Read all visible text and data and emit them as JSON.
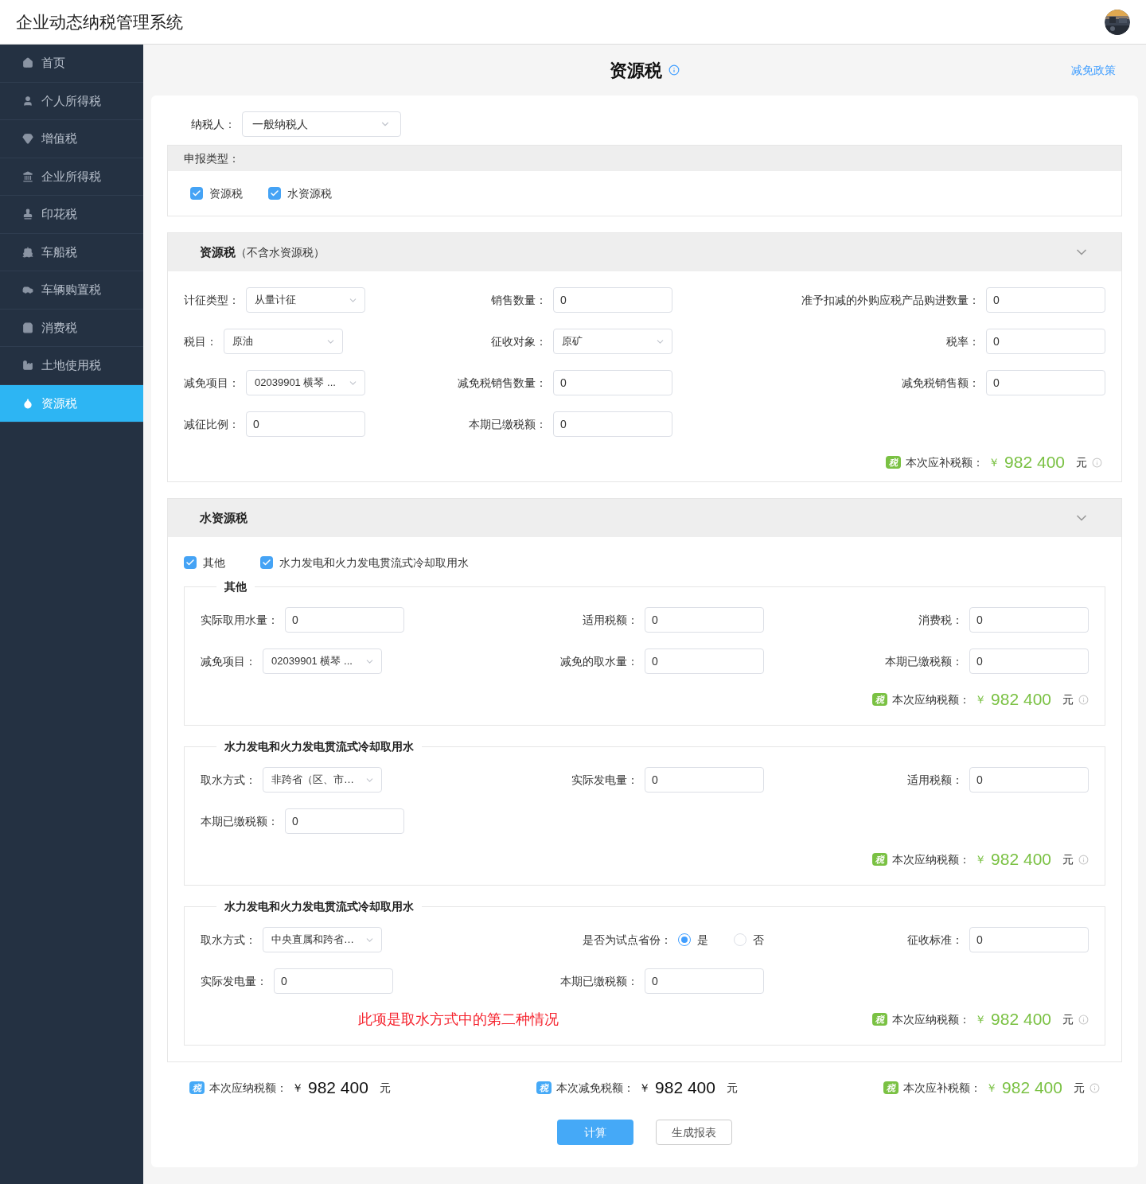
{
  "header": {
    "title": "企业动态纳税管理系统"
  },
  "sidebar": {
    "items": [
      {
        "label": "首页",
        "selected": false
      },
      {
        "label": "个人所得税",
        "selected": false
      },
      {
        "label": "增值税",
        "selected": false
      },
      {
        "label": "企业所得税",
        "selected": false
      },
      {
        "label": "印花税",
        "selected": false
      },
      {
        "label": "车船税",
        "selected": false
      },
      {
        "label": "车辆购置税",
        "selected": false
      },
      {
        "label": "消费税",
        "selected": false
      },
      {
        "label": "土地使用税",
        "selected": false
      },
      {
        "label": "资源税",
        "selected": true
      }
    ]
  },
  "page": {
    "title": "资源税",
    "policy_link": "减免政策"
  },
  "taxpayer": {
    "label": "纳税人：",
    "value": "一般纳税人"
  },
  "declare_type": {
    "label": "申报类型：",
    "options": [
      {
        "label": "资源税",
        "checked": true
      },
      {
        "label": "水资源税",
        "checked": true
      }
    ]
  },
  "resource_section": {
    "title": "资源税",
    "subtitle": "（不含水资源税）",
    "expanded": true,
    "rows": [
      [
        {
          "kind": "select",
          "label": "计征类型：",
          "value": "从量计征"
        },
        {
          "kind": "input",
          "label": "销售数量：",
          "value": "0"
        },
        {
          "kind": "input",
          "label": "准予扣减的外购应税产品购进数量：",
          "value": "0"
        }
      ],
      [
        {
          "kind": "select",
          "label": "税目：",
          "value": "原油"
        },
        {
          "kind": "select",
          "label": "征收对象：",
          "value": "原矿"
        },
        {
          "kind": "input",
          "label": "税率：",
          "value": "0"
        }
      ],
      [
        {
          "kind": "select",
          "label": "减免项目：",
          "value": "02039901 横琴 ..."
        },
        {
          "kind": "input",
          "label": "减免税销售数量：",
          "value": "0"
        },
        {
          "kind": "input",
          "label": "减免税销售额：",
          "value": "0"
        }
      ],
      [
        {
          "kind": "input",
          "label": "减征比例：",
          "value": "0"
        },
        {
          "kind": "input",
          "label": "本期已缴税额：",
          "value": "0"
        }
      ]
    ],
    "summary": {
      "kind": "highlight",
      "badge": "税",
      "label": "本次应补税额：",
      "currency": "￥",
      "amount": "982 400",
      "unit": "元"
    }
  },
  "water_section": {
    "title": "水资源税",
    "expanded": true,
    "options": [
      {
        "label": "其他",
        "checked": true
      },
      {
        "label": "水力发电和火力发电贯流式冷却取用水",
        "checked": true
      }
    ],
    "subsections": [
      {
        "title": "其他",
        "rows": [
          [
            {
              "kind": "input",
              "label": "实际取用水量：",
              "value": "0"
            },
            {
              "kind": "input",
              "label": "适用税额：",
              "value": "0"
            },
            {
              "kind": "input",
              "label": "消费税：",
              "value": "0"
            }
          ],
          [
            {
              "kind": "select",
              "label": "减免项目：",
              "value": "02039901 横琴 ..."
            },
            {
              "kind": "input",
              "label": "减免的取水量：",
              "value": "0"
            },
            {
              "kind": "input",
              "label": "本期已缴税额：",
              "value": "0"
            }
          ]
        ],
        "summary": {
          "kind": "highlight",
          "badge": "税",
          "label": "本次应纳税额：",
          "currency": "￥",
          "amount": "982 400",
          "unit": "元"
        }
      },
      {
        "title": "水力发电和火力发电贯流式冷却取用水",
        "rows": [
          [
            {
              "kind": "select",
              "label": "取水方式：",
              "value": "非跨省（区、市…"
            },
            {
              "kind": "input",
              "label": "实际发电量：",
              "value": "0"
            },
            {
              "kind": "input",
              "label": "适用税额：",
              "value": "0"
            }
          ],
          [
            {
              "kind": "input",
              "label": "本期已缴税额：",
              "value": "0"
            }
          ]
        ],
        "summary": {
          "kind": "highlight",
          "badge": "税",
          "label": "本次应纳税额：",
          "currency": "￥",
          "amount": "982 400",
          "unit": "元"
        }
      },
      {
        "title": "水力发电和火力发电贯流式冷却取用水",
        "rows": [
          [
            {
              "kind": "select",
              "label": "取水方式：",
              "value": "中央直属和跨省…"
            },
            {
              "kind": "radio",
              "label": "是否为试点省份：",
              "options": [
                {
                  "label": "是",
                  "selected": true
                },
                {
                  "label": "否",
                  "selected": false
                }
              ]
            },
            {
              "kind": "input",
              "label": "征收标准：",
              "value": "0"
            }
          ],
          [
            {
              "kind": "input",
              "label": "实际发电量：",
              "value": "0"
            },
            {
              "kind": "input",
              "label": "本期已缴税额：",
              "value": "0"
            }
          ]
        ],
        "note": "此项是取水方式中的第二种情况",
        "summary": {
          "kind": "highlight",
          "badge": "税",
          "label": "本次应纳税额：",
          "currency": "￥",
          "amount": "982 400",
          "unit": "元"
        }
      }
    ]
  },
  "totals": [
    {
      "kind": "plain",
      "badge": "税",
      "label": "本次应纳税额：",
      "currency": "￥",
      "amount": "982 400",
      "unit": "元"
    },
    {
      "kind": "plain",
      "badge": "税",
      "label": "本次减免税额：",
      "currency": "￥",
      "amount": "982 400",
      "unit": "元"
    },
    {
      "kind": "highlight",
      "badge": "税",
      "label": "本次应补税额：",
      "currency": "￥",
      "amount": "982 400",
      "unit": "元"
    }
  ],
  "buttons": [
    {
      "label": "计算",
      "kind": "primary"
    },
    {
      "label": "生成报表",
      "kind": "default"
    }
  ]
}
